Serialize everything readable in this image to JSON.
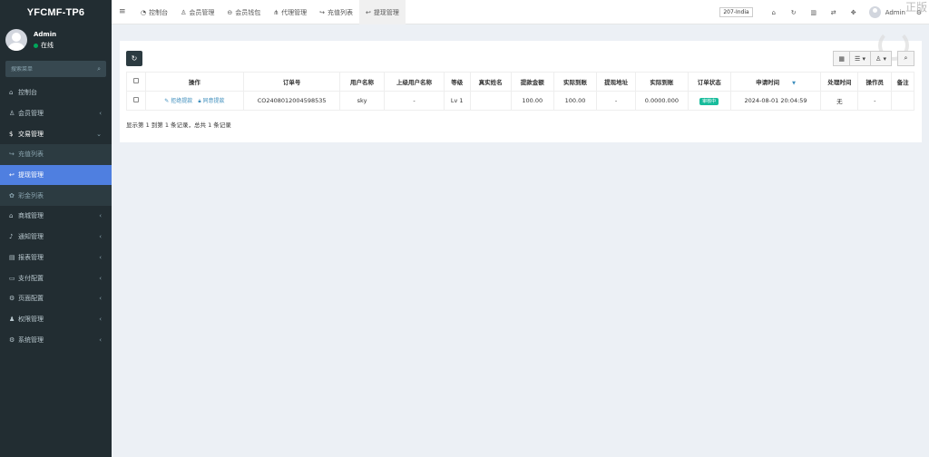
{
  "app": {
    "logo": "YFCMF-TP6"
  },
  "user": {
    "name": "Admin",
    "status": "在线"
  },
  "search": {
    "placeholder": "搜索菜单"
  },
  "sidebar": {
    "items": [
      {
        "label": "控制台",
        "icon": "dashboard-icon",
        "glyph": "⌂",
        "chevron": ""
      },
      {
        "label": "会员管理",
        "icon": "user-icon",
        "glyph": "♙",
        "chevron": "‹"
      },
      {
        "label": "交易管理",
        "icon": "dollar-icon",
        "glyph": "$",
        "chevron": "⌄"
      }
    ],
    "sub_items": [
      {
        "label": "充值列表",
        "icon": "sign-in-icon",
        "glyph": "↪"
      },
      {
        "label": "提现管理",
        "icon": "sign-out-icon",
        "glyph": "↩"
      },
      {
        "label": "彩金列表",
        "icon": "gift-icon",
        "glyph": "✿"
      }
    ],
    "items2": [
      {
        "label": "商城管理",
        "icon": "home-icon",
        "glyph": "⌂",
        "chevron": "‹"
      },
      {
        "label": "通知管理",
        "icon": "bell-icon",
        "glyph": "♪",
        "chevron": "‹"
      },
      {
        "label": "报表管理",
        "icon": "chart-icon",
        "glyph": "▤",
        "chevron": "‹"
      },
      {
        "label": "支付配置",
        "icon": "credit-card-icon",
        "glyph": "▭",
        "chevron": "‹"
      },
      {
        "label": "页面配置",
        "icon": "gear-icon",
        "glyph": "⚙",
        "chevron": "‹"
      },
      {
        "label": "权限管理",
        "icon": "group-icon",
        "glyph": "♟",
        "chevron": "‹"
      },
      {
        "label": "系统管理",
        "icon": "cogs-icon",
        "glyph": "⚙",
        "chevron": "‹"
      }
    ]
  },
  "navbar": {
    "tabs": [
      {
        "label": "控制台",
        "icon": "dashboard-icon",
        "glyph": "◔",
        "active": false
      },
      {
        "label": "会员管理",
        "icon": "user-icon",
        "glyph": "♙",
        "active": false
      },
      {
        "label": "会员钱包",
        "icon": "wallet-icon",
        "glyph": "⊖",
        "active": false
      },
      {
        "label": "代理管理",
        "icon": "sitemap-icon",
        "glyph": "⋔",
        "active": false
      },
      {
        "label": "充值列表",
        "icon": "sign-in-icon",
        "glyph": "↪",
        "active": false
      },
      {
        "label": "提现管理",
        "icon": "sign-out-icon",
        "glyph": "↩",
        "active": true
      }
    ],
    "lang": "207-India",
    "user": "Admin",
    "watermark": "正版"
  },
  "table": {
    "headers": [
      "操作",
      "订单号",
      "用户名称",
      "上级用户名称",
      "等级",
      "真实姓名",
      "提款金额",
      "实际到账",
      "提现地址",
      "实际到账",
      "订单状态",
      "申请时间",
      "处理时间",
      "操作员",
      "备注"
    ],
    "rows": [
      {
        "action1": "拒绝提款",
        "action2": "同意提款",
        "order_no": "CO2408012004598535",
        "username": "sky",
        "parent": "-",
        "level": "Lv 1",
        "real_name": "",
        "amount": "100.00",
        "actual": "100.00",
        "address": "-",
        "actual2": "0.0000.000",
        "status": "审核中",
        "apply_time": "2024-08-01 20:04:59",
        "process_time": "无",
        "operator": "-",
        "remark": ""
      }
    ],
    "footer": "显示第 1 到第 1 条记录，总共 1 条记录"
  },
  "colors": {
    "sidebar_bg": "#222d32",
    "active_item": "#4f7fe0",
    "status_green": "#18bc9c"
  }
}
